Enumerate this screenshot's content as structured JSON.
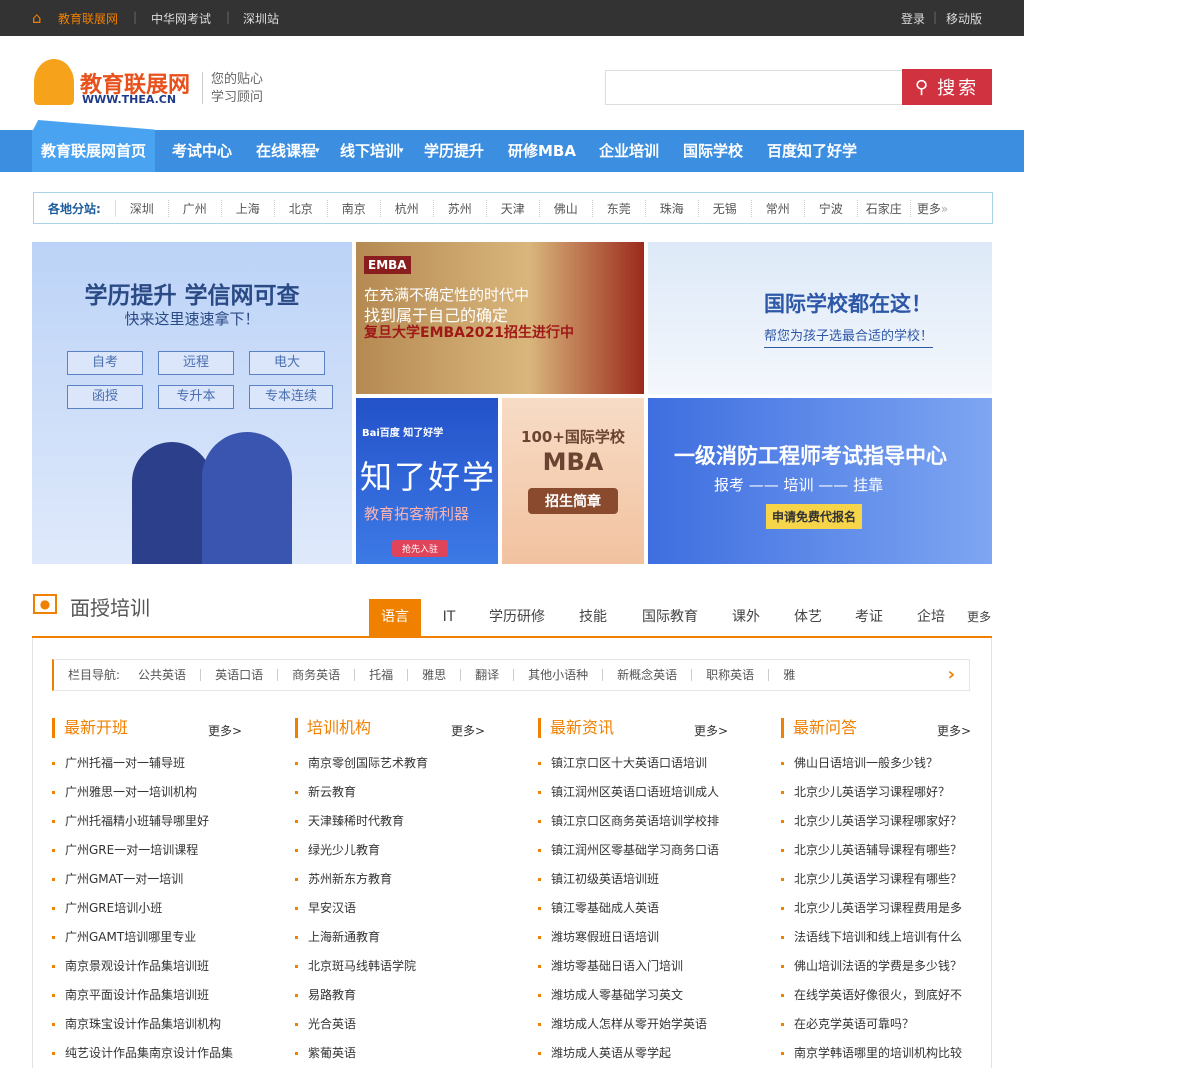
{
  "topbar": {
    "home": "教育联展网",
    "links": [
      "中华网考试",
      "深圳站"
    ],
    "login": "登录",
    "mobile": "移动版"
  },
  "logo": {
    "name": "教育联展网",
    "url": "WWW.THEA.CN",
    "slogan1": "您的贴心",
    "slogan2": "学习顾问"
  },
  "search": {
    "value": "",
    "button": "搜索"
  },
  "nav": [
    "教育联展网首页",
    "考试中心",
    "在线课程",
    "线下培训",
    "学历提升",
    "研修MBA",
    "企业培训",
    "国际学校",
    "百度知了好学"
  ],
  "branches": {
    "label": "各地分站:",
    "cities": [
      "深圳",
      "广州",
      "上海",
      "北京",
      "南京",
      "杭州",
      "苏州",
      "天津",
      "佛山",
      "东莞",
      "珠海",
      "无锡",
      "常州",
      "宁波",
      "石家庄"
    ],
    "more": "更多"
  },
  "banners": {
    "b1": {
      "title": "学历提升 学信网可查",
      "sub": "快来这里速速拿下！",
      "buttons": [
        "自考",
        "远程",
        "电大",
        "函授",
        "专升本",
        "专本连续"
      ]
    },
    "b2": {
      "logo": "EMBA",
      "l1": "在充满不确定性的时代中",
      "l2": "找到属于自己的确定",
      "l3": "复旦大学EMBA2021招生进行中"
    },
    "b3": {
      "title": "国际学校都在这！",
      "sub": "帮您为孩子选最合适的学校！"
    },
    "b4": {
      "brand": "Bai百度 知了好学",
      "title": "知了好学",
      "sub": "教育拓客新利器",
      "btn": "抢先入驻"
    },
    "b5": {
      "l1": "100+国际学校",
      "l2": "MBA",
      "btn": "招生简章"
    },
    "b6": {
      "title": "一级消防工程师考试指导中心",
      "steps": "报考 —— 培训 —— 挂靠",
      "btn": "申请免费代报名"
    }
  },
  "section": {
    "title": "面授培训",
    "tabs": [
      "语言",
      "IT",
      "学历研修",
      "技能",
      "国际教育",
      "课外",
      "体艺",
      "考证",
      "企培"
    ],
    "more": "更多",
    "subnav_label": "栏目导航:",
    "subnav": [
      "公共英语",
      "英语口语",
      "商务英语",
      "托福",
      "雅思",
      "翻译",
      "其他小语种",
      "新概念英语",
      "职称英语",
      "雅"
    ]
  },
  "columns": [
    {
      "title": "最新开班",
      "more": "更多>",
      "items": [
        "广州托福一对一辅导班",
        "广州雅思一对一培训机构",
        "广州托福精小班辅导哪里好",
        "广州GRE一对一培训课程",
        "广州GMAT一对一培训",
        "广州GRE培训小班",
        "广州GAMT培训哪里专业",
        "南京景观设计作品集培训班",
        "南京平面设计作品集培训班",
        "南京珠宝设计作品集培训机构",
        "纯艺设计作品集南京设计作品集"
      ]
    },
    {
      "title": "培训机构",
      "more": "更多>",
      "items": [
        "南京零创国际艺术教育",
        "新云教育",
        "天津臻稀时代教育",
        "绿光少儿教育",
        "苏州新东方教育",
        "早安汉语",
        "上海新通教育",
        "北京斑马线韩语学院",
        "易路教育",
        "光合英语",
        "紫葡英语"
      ]
    },
    {
      "title": "最新资讯",
      "more": "更多>",
      "items": [
        "镇江京口区十大英语口语培训",
        "镇江润州区英语口语班培训成人",
        "镇江京口区商务英语培训学校排",
        "镇江润州区零基础学习商务口语",
        "镇江初级英语培训班",
        "镇江零基础成人英语",
        "潍坊寒假班日语培训",
        "潍坊零基础日语入门培训",
        "潍坊成人零基础学习英文",
        "潍坊成人怎样从零开始学英语",
        "潍坊成人英语从零学起"
      ]
    },
    {
      "title": "最新问答",
      "more": "更多>",
      "items": [
        "佛山日语培训一般多少钱？",
        "北京少儿英语学习课程哪好？",
        "北京少儿英语学习课程哪家好？",
        "北京少儿英语辅导课程有哪些？",
        "北京少儿英语学习课程有哪些？",
        "北京少儿英语学习课程费用是多",
        "法语线下培训和线上培训有什么",
        "佛山培训法语的学费是多少钱？",
        "在线学英语好像很火，到底好不",
        "在必克学英语可靠吗？",
        "南京学韩语哪里的培训机构比较"
      ]
    }
  ]
}
